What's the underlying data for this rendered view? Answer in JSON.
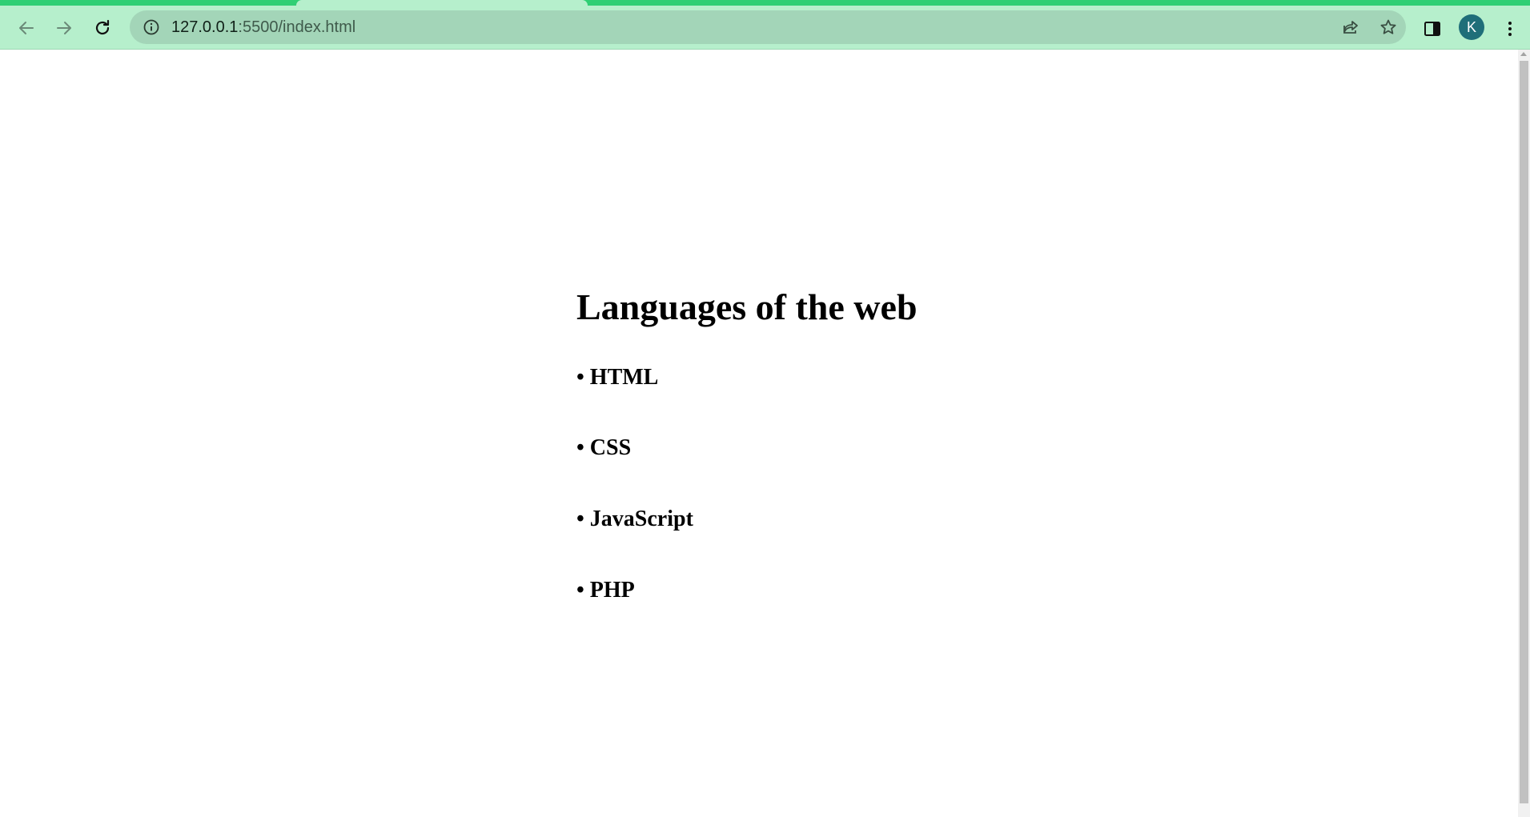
{
  "browser": {
    "url_host": "127.0.0.1",
    "url_rest": ":5500/index.html",
    "profile_initial": "K",
    "icons": {
      "back": "arrow-left-icon",
      "forward": "arrow-right-icon",
      "reload": "reload-icon",
      "site_info": "info-icon",
      "share": "share-icon",
      "bookmark": "star-icon",
      "side_panel": "side-panel-icon",
      "menu": "kebab-menu-icon"
    },
    "colors": {
      "toolbar": "#b6efcc",
      "tab_strip": "#2fcf74",
      "omnibox": "#a3d5b8",
      "avatar": "#1f6e79"
    }
  },
  "page": {
    "heading": "Languages of the web",
    "items": [
      "• HTML",
      "• CSS",
      "• JavaScript",
      "• PHP"
    ]
  }
}
